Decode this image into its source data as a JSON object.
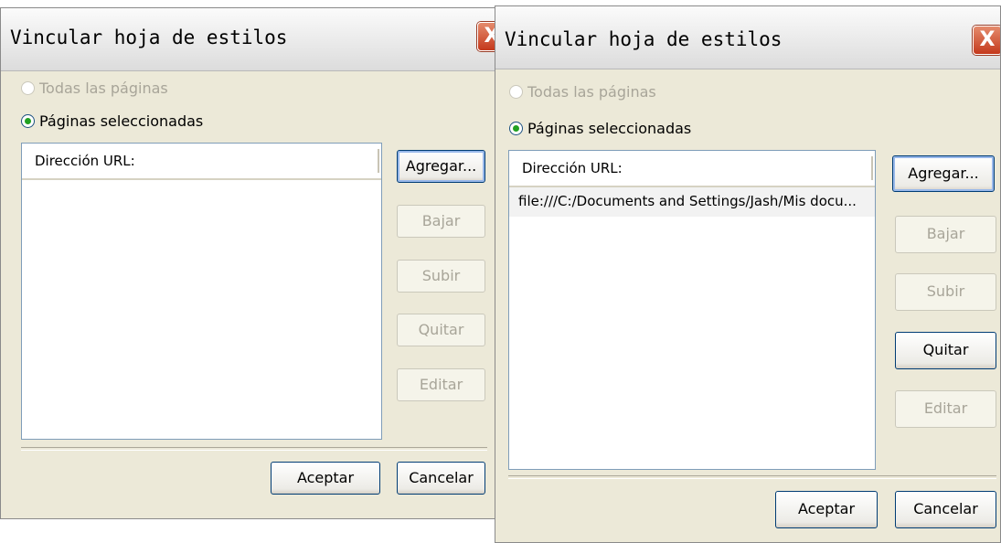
{
  "dialogs": [
    {
      "title": "Vincular hoja de estilos",
      "close_glyph": "X",
      "radio_all": "Todas las páginas",
      "radio_selected": "Páginas seleccionadas",
      "list_header": "Dirección URL:",
      "rows": [],
      "btn_add": "Agregar...",
      "btn_down": "Bajar",
      "btn_up": "Subir",
      "btn_remove": "Quitar",
      "btn_edit": "Editar",
      "btn_ok": "Aceptar",
      "btn_cancel": "Cancelar"
    },
    {
      "title": "Vincular hoja de estilos",
      "close_glyph": "X",
      "radio_all": "Todas las páginas",
      "radio_selected": "Páginas seleccionadas",
      "list_header": "Dirección URL:",
      "rows": [
        "file:///C:/Documents and Settings/Jash/Mis docu..."
      ],
      "btn_add": "Agregar...",
      "btn_down": "Bajar",
      "btn_up": "Subir",
      "btn_remove": "Quitar",
      "btn_edit": "Editar",
      "btn_ok": "Aceptar",
      "btn_cancel": "Cancelar"
    }
  ],
  "colors": {
    "dialog_bg": "#ece9d8",
    "close_button": "#c4391c",
    "radio_check": "#21a121",
    "disabled_text": "#a8a599",
    "list_border": "#7f9db9"
  },
  "icons": {
    "close": "close-icon",
    "radio": "radio-button-icon"
  }
}
